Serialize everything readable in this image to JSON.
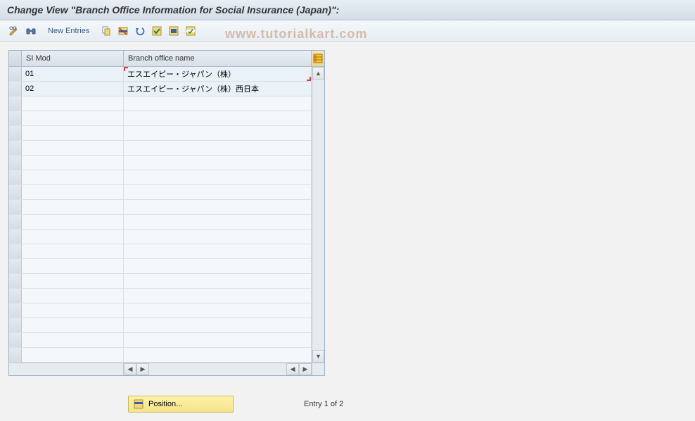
{
  "title": "Change View \"Branch Office Information for Social Insurance (Japan)\":",
  "toolbar": {
    "new_entries_label": "New Entries"
  },
  "watermark": "www.tutorialkart.com",
  "table": {
    "headers": {
      "simod": "SI Mod",
      "branch": "Branch office name"
    },
    "rows": [
      {
        "simod": "01",
        "branch": "エスエイピー・ジャパン（株）",
        "selected": true
      },
      {
        "simod": "02",
        "branch": "エスエイピー・ジャパン（株）西日本",
        "selected": false
      }
    ],
    "empty_row_count": 18
  },
  "footer": {
    "position_label": "Position...",
    "entry_text": "Entry 1 of 2"
  }
}
